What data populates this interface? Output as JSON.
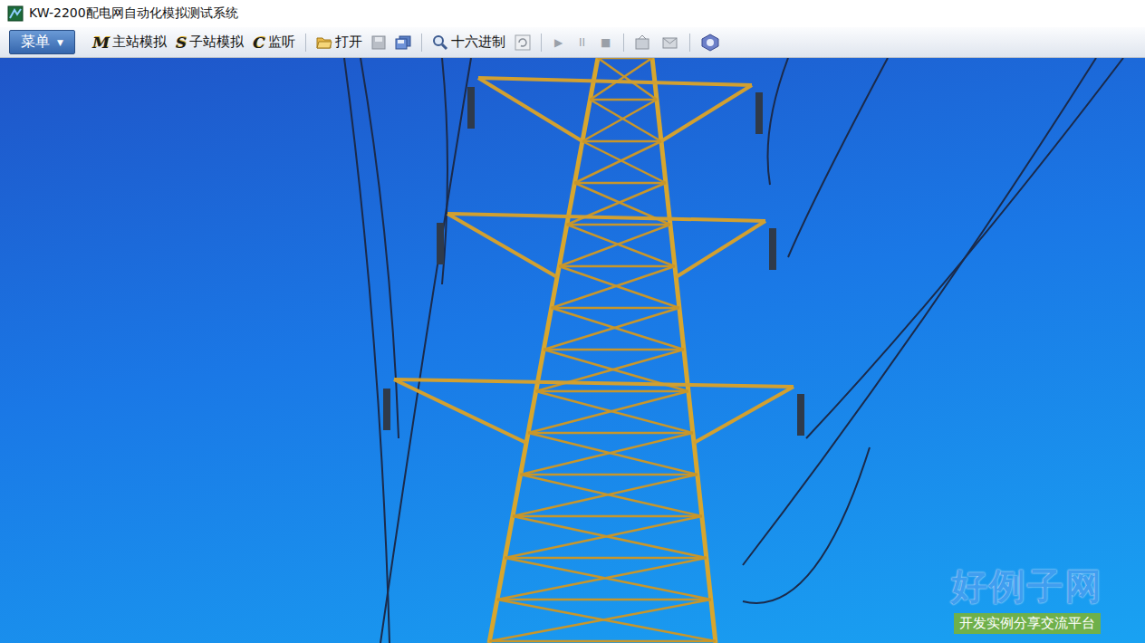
{
  "window": {
    "title": "KW-2200配电网自动化模拟测试系统"
  },
  "menu_button": {
    "label": "菜单",
    "arrow": "▼"
  },
  "toolbar": [
    {
      "kind": "letter",
      "glyph": "M",
      "label": "主站模拟",
      "disabled": false
    },
    {
      "kind": "letter",
      "glyph": "S",
      "label": "子站模拟",
      "disabled": false
    },
    {
      "kind": "letter",
      "glyph": "C",
      "label": "监听",
      "disabled": false
    },
    {
      "kind": "separator"
    },
    {
      "kind": "folder",
      "label": "打开",
      "disabled": false
    },
    {
      "kind": "save",
      "disabled": true
    },
    {
      "kind": "save-all",
      "disabled": false
    },
    {
      "kind": "separator"
    },
    {
      "kind": "hex",
      "label": "十六进制",
      "disabled": false
    },
    {
      "kind": "refresh",
      "disabled": true
    },
    {
      "kind": "separator"
    },
    {
      "kind": "glyph",
      "glyph": "▶",
      "disabled": true
    },
    {
      "kind": "glyph",
      "glyph": "II",
      "disabled": true
    },
    {
      "kind": "glyph",
      "glyph": "■",
      "disabled": true
    },
    {
      "kind": "separator"
    },
    {
      "kind": "props",
      "disabled": true
    },
    {
      "kind": "mail",
      "disabled": true
    },
    {
      "kind": "separator"
    },
    {
      "kind": "help",
      "disabled": false
    }
  ],
  "watermark": {
    "logo": "好例子网",
    "tagline": "开发实例分享交流平台"
  }
}
